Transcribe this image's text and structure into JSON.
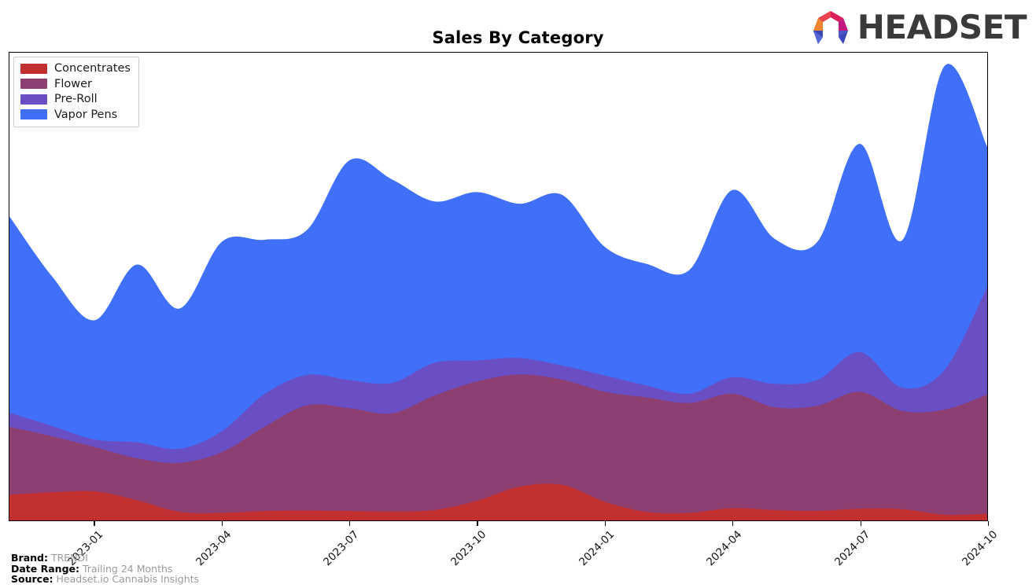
{
  "header": {
    "title": "Sales By Category",
    "logo_text": "HEADSET",
    "logo_icon": "headset-hexagon-logo"
  },
  "legend": {
    "position": "top-left",
    "items": [
      {
        "label": "Concentrates",
        "color": "#c23030"
      },
      {
        "label": "Flower",
        "color": "#8d3f72"
      },
      {
        "label": "Pre-Roll",
        "color": "#6a4ec4"
      },
      {
        "label": "Vapor Pens",
        "color": "#4070fa"
      }
    ]
  },
  "footer": {
    "brand_key": "Brand:",
    "brand_value": "TRENDI",
    "date_range_key": "Date Range:",
    "date_range_value": "Trailing 24 Months",
    "source_key": "Source:",
    "source_value": "Headset.io Cannabis Insights"
  },
  "chart_data": {
    "type": "area",
    "stacked": true,
    "interpolation": "smooth-spline",
    "title": "Sales By Category",
    "xlabel": "",
    "ylabel": "",
    "grid": false,
    "legend_position": "top-left",
    "ylim": [
      0,
      100
    ],
    "axis_visible": {
      "x": true,
      "y": false
    },
    "x": [
      "2022-11",
      "2022-12",
      "2023-01",
      "2023-02",
      "2023-03",
      "2023-04",
      "2023-05",
      "2023-06",
      "2023-07",
      "2023-08",
      "2023-09",
      "2023-10",
      "2023-11",
      "2023-12",
      "2024-01",
      "2024-02",
      "2024-03",
      "2024-04",
      "2024-05",
      "2024-06",
      "2024-07",
      "2024-08",
      "2024-09",
      "2024-10"
    ],
    "tick_labels": [
      "2023-01",
      "2023-04",
      "2023-07",
      "2023-10",
      "2024-01",
      "2024-04",
      "2024-07",
      "2024-10"
    ],
    "tick_positions": [
      2,
      5,
      8,
      11,
      14,
      17,
      20,
      23
    ],
    "series": [
      {
        "name": "Concentrates",
        "color": "#c23030",
        "values": [
          5.5,
          6.0,
          6.2,
          4.3,
          1.8,
          1.6,
          2.0,
          2.1,
          2.0,
          1.9,
          2.2,
          4.2,
          7.2,
          7.6,
          4.0,
          1.8,
          1.6,
          2.6,
          2.2,
          2.0,
          2.5,
          2.4,
          1.2,
          1.4
        ]
      },
      {
        "name": "Flower",
        "color": "#8d3f72",
        "values": [
          14.5,
          12.0,
          9.5,
          9.0,
          10.5,
          13.0,
          18.0,
          22.5,
          22.0,
          21.0,
          24.5,
          25.5,
          24.0,
          22.5,
          23.5,
          24.5,
          23.5,
          24.5,
          22.0,
          22.5,
          25.0,
          21.0,
          22.5,
          25.5
        ]
      },
      {
        "name": "Pre-Roll",
        "color": "#6a4ec4",
        "values": [
          3.0,
          2.2,
          1.6,
          3.4,
          3.0,
          4.5,
          7.0,
          6.5,
          6.0,
          6.5,
          7.0,
          4.5,
          3.5,
          3.0,
          3.5,
          2.5,
          2.0,
          3.5,
          5.0,
          5.5,
          8.5,
          5.0,
          8.5,
          23.0
        ]
      },
      {
        "name": "Vapor Pens",
        "color": "#4070fa",
        "values": [
          42.0,
          32.0,
          25.5,
          38.0,
          30.0,
          40.5,
          33.0,
          31.0,
          47.0,
          43.5,
          34.5,
          36.0,
          33.0,
          36.5,
          27.5,
          26.0,
          26.5,
          40.0,
          31.0,
          29.5,
          44.5,
          31.5,
          65.0,
          30.0
        ]
      }
    ]
  }
}
